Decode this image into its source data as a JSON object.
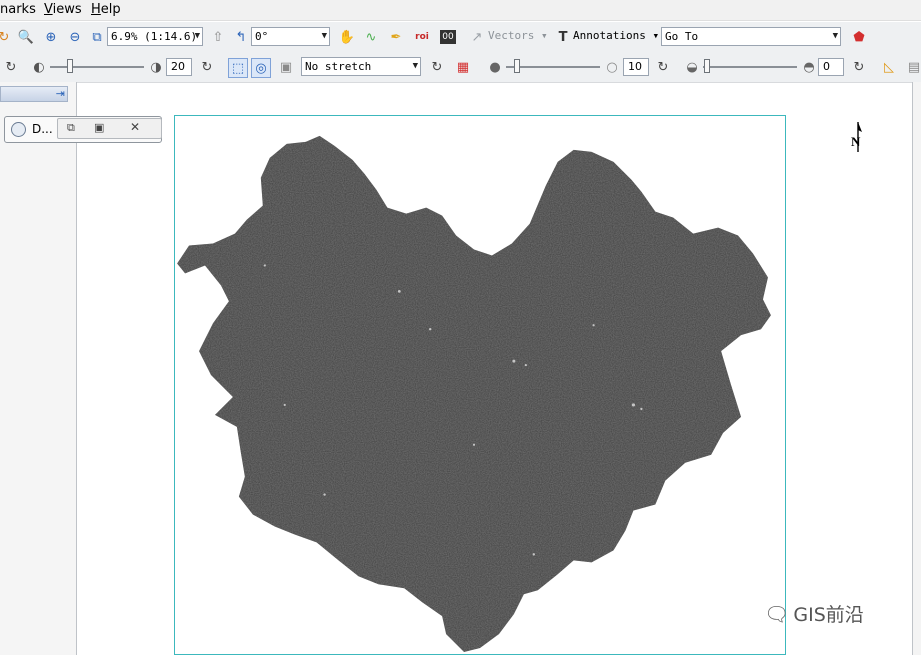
{
  "menu": {
    "items": [
      "narks",
      "Views",
      "Help"
    ],
    "underline": [
      "",
      "V",
      "H"
    ]
  },
  "toolbar1": {
    "scale_value": "6.9% (1:14.6)",
    "rotation_value": "0°",
    "vectors_label": "Vectors",
    "annotations_label": "Annotations",
    "goto_value": "Go To"
  },
  "toolbar2": {
    "brightness_value": "20",
    "stretch_value": "No stretch",
    "contrast_value": "10",
    "transparency_value": "0"
  },
  "floating_toolbar": {
    "label": "D..."
  },
  "watermark": {
    "text": "GIS前沿"
  },
  "colors": {
    "accent": "#3cb8bd",
    "raster": "#404040"
  }
}
